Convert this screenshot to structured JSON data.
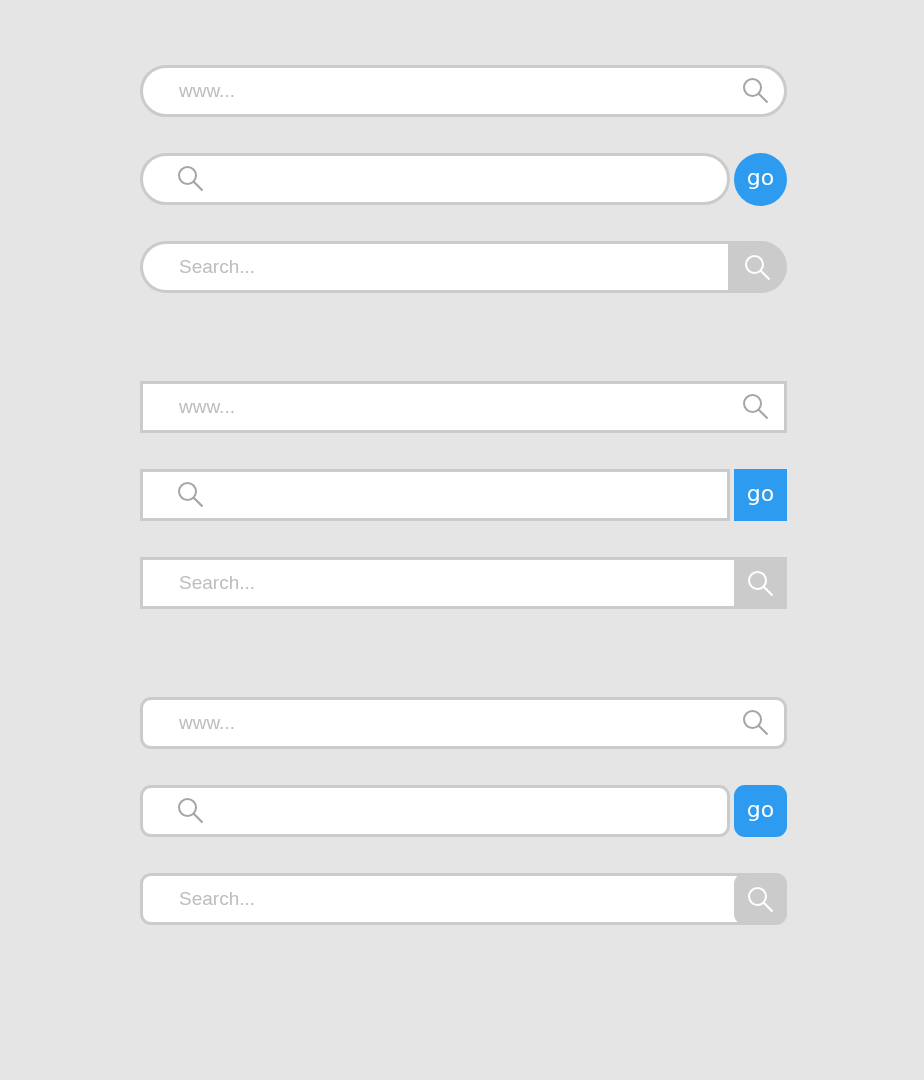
{
  "groups": [
    {
      "kind": "pill",
      "bars": [
        {
          "kind": "url",
          "placeholder": "www..."
        },
        {
          "kind": "go",
          "button": "go"
        },
        {
          "kind": "search",
          "placeholder": "Search..."
        }
      ]
    },
    {
      "kind": "square",
      "bars": [
        {
          "kind": "url",
          "placeholder": "www..."
        },
        {
          "kind": "go",
          "button": "go"
        },
        {
          "kind": "search",
          "placeholder": "Search..."
        }
      ]
    },
    {
      "kind": "rounded",
      "bars": [
        {
          "kind": "url",
          "placeholder": "www..."
        },
        {
          "kind": "go",
          "button": "go"
        },
        {
          "kind": "search",
          "placeholder": "Search..."
        }
      ]
    }
  ]
}
